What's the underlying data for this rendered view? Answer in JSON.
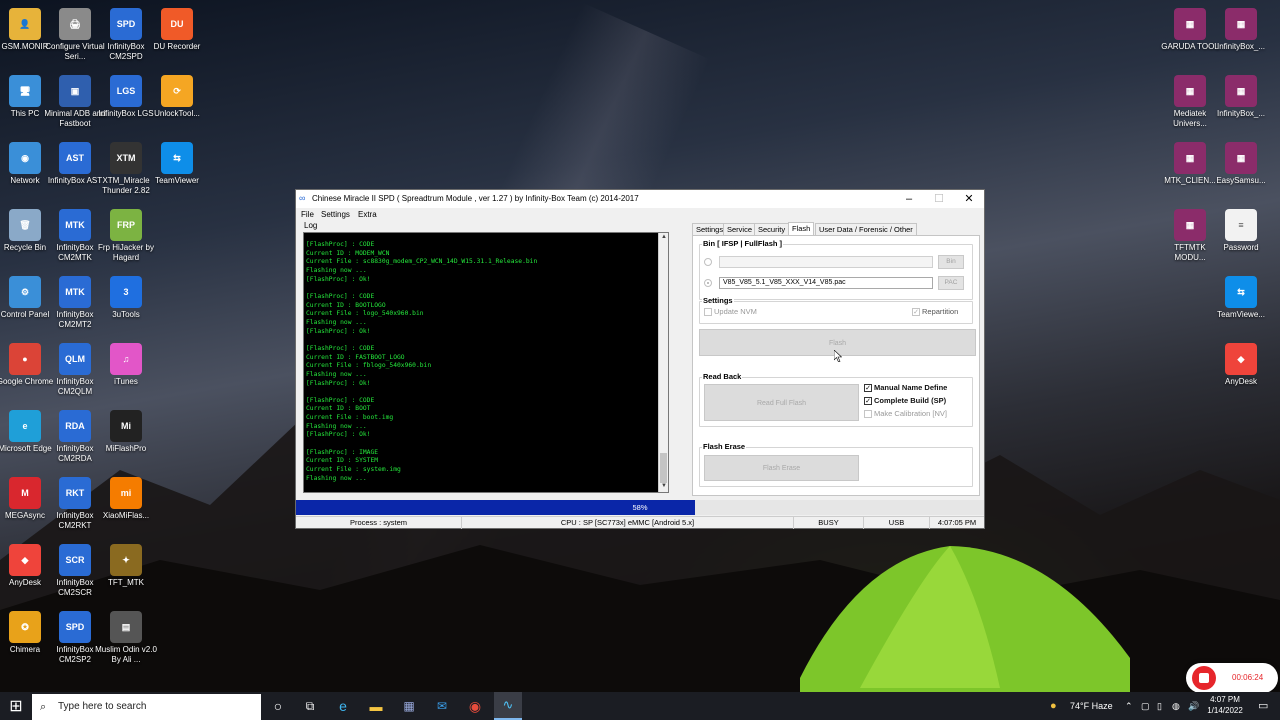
{
  "desktop": {
    "icons": [
      {
        "label": "GSM.MONIR",
        "color": "#e7b33a",
        "glyph": "👤",
        "icon": "user-folder-icon"
      },
      {
        "label": "Configure Virtual Seri...",
        "color": "#8a8a8a",
        "glyph": "🖨",
        "icon": "printer-icon"
      },
      {
        "label": "InfinityBox CM2SPD",
        "color": "#2a6bd4",
        "glyph": "SPD",
        "icon": "infinitybox-icon"
      },
      {
        "label": "DU Recorder",
        "color": "#f05a28",
        "glyph": "DU",
        "icon": "du-recorder-icon"
      },
      {
        "label": "This PC",
        "color": "#3a8fd8",
        "glyph": "🖥",
        "icon": "computer-icon"
      },
      {
        "label": "Minimal ADB and Fastboot",
        "color": "#2f5fae",
        "glyph": "▣",
        "icon": "adb-icon"
      },
      {
        "label": "InfinityBox LGS",
        "color": "#2a6bd4",
        "glyph": "LGS",
        "icon": "infinitybox-icon"
      },
      {
        "label": "UnlockTool...",
        "color": "#f5a623",
        "glyph": "⟳",
        "icon": "unlocktool-icon"
      },
      {
        "label": "Network",
        "color": "#3a8fd8",
        "glyph": "◉",
        "icon": "network-icon"
      },
      {
        "label": "InfinityBox AST",
        "color": "#2a6bd4",
        "glyph": "AST",
        "icon": "infinitybox-icon"
      },
      {
        "label": "XTM_Miracle Thunder 2.82",
        "color": "#333333",
        "glyph": "XTM",
        "icon": "miracle-thunder-icon"
      },
      {
        "label": "TeamViewer",
        "color": "#0e8ee9",
        "glyph": "⇆",
        "icon": "teamviewer-icon"
      },
      {
        "label": "Recycle Bin",
        "color": "#8aa9c8",
        "glyph": "🗑",
        "icon": "recycle-bin-icon"
      },
      {
        "label": "InfinityBox CM2MTK",
        "color": "#2a6bd4",
        "glyph": "MTK",
        "icon": "infinitybox-icon"
      },
      {
        "label": "Frp HiJacker by Hagard",
        "color": "#7cb342",
        "glyph": "FRP",
        "icon": "frp-hijacker-icon"
      },
      {
        "label": "Control Panel",
        "color": "#3a8fd8",
        "glyph": "⚙",
        "icon": "control-panel-icon"
      },
      {
        "label": "InfinityBox CM2MT2",
        "color": "#2a6bd4",
        "glyph": "MTK",
        "icon": "infinitybox-icon"
      },
      {
        "label": "3uTools",
        "color": "#1f6fe0",
        "glyph": "3",
        "icon": "3utools-icon"
      },
      {
        "label": "Google Chrome",
        "color": "#db4437",
        "glyph": "●",
        "icon": "chrome-icon"
      },
      {
        "label": "InfinityBox CM2QLM",
        "color": "#2a6bd4",
        "glyph": "QLM",
        "icon": "infinitybox-icon"
      },
      {
        "label": "iTunes",
        "color": "#e256c8",
        "glyph": "♫",
        "icon": "itunes-icon"
      },
      {
        "label": "Microsoft Edge",
        "color": "#1f9fd8",
        "glyph": "e",
        "icon": "edge-icon"
      },
      {
        "label": "InfinityBox CM2RDA",
        "color": "#2a6bd4",
        "glyph": "RDA",
        "icon": "infinitybox-icon"
      },
      {
        "label": "MiFlashPro",
        "color": "#222222",
        "glyph": "Mi",
        "icon": "miflashpro-icon"
      },
      {
        "label": "MEGAsync",
        "color": "#d9272e",
        "glyph": "M",
        "icon": "megasync-icon"
      },
      {
        "label": "InfinityBox CM2RKT",
        "color": "#2a6bd4",
        "glyph": "RKT",
        "icon": "infinitybox-icon"
      },
      {
        "label": "XiaoMiFlas...",
        "color": "#f57c00",
        "glyph": "mi",
        "icon": "xiaomiflash-icon"
      },
      {
        "label": "AnyDesk",
        "color": "#ef443b",
        "glyph": "◆",
        "icon": "anydesk-icon"
      },
      {
        "label": "InfinityBox CM2SCR",
        "color": "#2a6bd4",
        "glyph": "SCR",
        "icon": "infinitybox-icon"
      },
      {
        "label": "TFT_MTK",
        "color": "#8a6a20",
        "glyph": "✦",
        "icon": "tft-mtk-icon"
      },
      {
        "label": "Chimera",
        "color": "#e8a21a",
        "glyph": "✪",
        "icon": "chimera-icon"
      },
      {
        "label": "InfinityBox CM2SP2",
        "color": "#2a6bd4",
        "glyph": "SPD",
        "icon": "infinitybox-icon"
      },
      {
        "label": "Muslim Odin v2.0 By Ali ...",
        "color": "#555555",
        "glyph": "▤",
        "icon": "odin-icon"
      },
      {
        "label": "GARUDA TOOL",
        "color": "#8b2c6a",
        "glyph": "▦",
        "icon": "winrar-icon"
      },
      {
        "label": "InfinityBox_...",
        "color": "#8b2c6a",
        "glyph": "▦",
        "icon": "winrar-icon"
      },
      {
        "label": "Mediatek Univers...",
        "color": "#8b2c6a",
        "glyph": "▦",
        "icon": "winrar-icon"
      },
      {
        "label": "InfinityBox_...",
        "color": "#8b2c6a",
        "glyph": "▦",
        "icon": "winrar-icon"
      },
      {
        "label": "MTK_CLIEN...",
        "color": "#8b2c6a",
        "glyph": "▦",
        "icon": "winrar-icon"
      },
      {
        "label": "EasySamsu...",
        "color": "#8b2c6a",
        "glyph": "▦",
        "icon": "winrar-icon"
      },
      {
        "label": "TFTMTK MODU...",
        "color": "#8b2c6a",
        "glyph": "▦",
        "icon": "winrar-icon"
      },
      {
        "label": "Password",
        "color": "#f2f2f2",
        "glyph": "≡",
        "icon": "text-file-icon"
      },
      {
        "label": "TeamViewe...",
        "color": "#0e8ee9",
        "glyph": "⇆",
        "icon": "teamviewer-icon"
      },
      {
        "label": "AnyDesk",
        "color": "#ef443b",
        "glyph": "◆",
        "icon": "anydesk-icon"
      }
    ]
  },
  "window": {
    "title": "Chinese Miracle II SPD ( Spreadtrum Module , ver 1.27 ) by Infinity-Box Team (c) 2014-2017",
    "menu": [
      "File",
      "Settings",
      "Extra"
    ],
    "log_label": "Log",
    "log_lines": [
      "[FlashProc] : CODE",
      "Current ID : MODEM_WCN",
      "Current File : sc8830g_modem_CP2_WCN_14D_W15.31.1_Release.bin",
      "Flashing now ...",
      "[FlashProc] : Ok!",
      "",
      "[FlashProc] : CODE",
      "Current ID : BOOTLOGO",
      "Current File : logo_540x960.bin",
      "Flashing now ...",
      "[FlashProc] : Ok!",
      "",
      "[FlashProc] : CODE",
      "Current ID : FASTBOOT_LOGO",
      "Current File : fblogo_540x960.bin",
      "Flashing now ...",
      "[FlashProc] : Ok!",
      "",
      "[FlashProc] : CODE",
      "Current ID : BOOT",
      "Current File : boot.img",
      "Flashing now ...",
      "[FlashProc] : Ok!",
      "",
      "[FlashProc] : IMAGE",
      "Current ID : SYSTEM",
      "Current File : system.img",
      "Flashing now ..."
    ],
    "tabs": [
      "Settings",
      "Service",
      "Security",
      "Flash",
      "User Data / Forensic / Other"
    ],
    "active_tab": "Flash",
    "bin_group": "Bin  [ IFSP | FullFlash ]",
    "bin_path": "",
    "bin_button": "Bin",
    "pac_path": "V85_V85_5.1_V85_XXX_V14_V85.pac",
    "pac_button": "PAC",
    "settings_group": "Settings",
    "update_nvm": "Update NVM",
    "repartition": "Repartition",
    "flash_button": "Flash",
    "readback_group": "Read Back",
    "read_full_flash": "Read Full Flash",
    "manual_name_define": "Manual Name Define",
    "complete_build": "Complete Build (SP)",
    "make_calibration": "Make Calibration [NV]",
    "flash_erase_group": "Flash Erase",
    "flash_erase_button": "Flash Erase",
    "progress_percent": 58,
    "progress_text": "58%",
    "status": {
      "process": "Process : system",
      "cpu": "CPU : SP [SC773x] eMMC [Android 5.x]",
      "state": "BUSY",
      "port": "USB",
      "time": "4:07:05 PM"
    }
  },
  "taskbar": {
    "search_placeholder": "Type here to search",
    "weather": "74°F  Haze",
    "clock_time": "4:07 PM",
    "clock_date": "1/14/2022",
    "recording_time": "00:06:24"
  },
  "colors": {
    "log_text": "#25e83c",
    "progress": "#0a26a8",
    "accent": "#0078d7"
  }
}
